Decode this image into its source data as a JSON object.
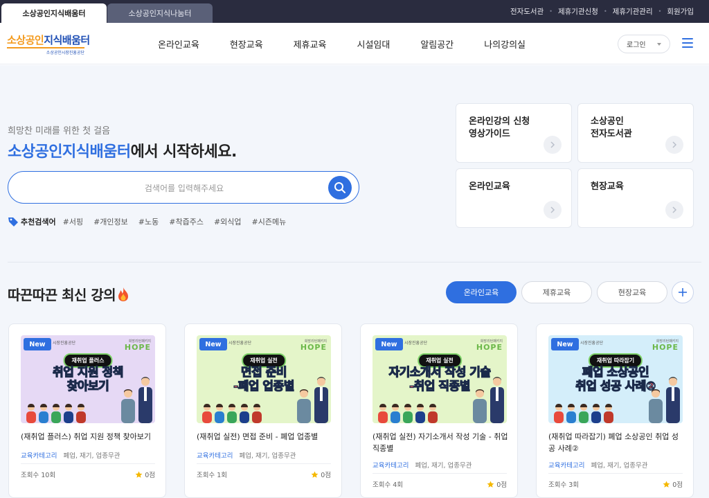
{
  "top_tabs": [
    "소상공인지식배움터",
    "소상공인지식나눔터"
  ],
  "top_links": [
    "전자도서관",
    "제휴기관신청",
    "제휴기관관리",
    "회원가입"
  ],
  "logo": {
    "main_orange": "소상공인",
    "main_blue": "지식배움터",
    "sub": "소상공인시장진흥공단"
  },
  "nav": [
    "온라인교육",
    "현장교육",
    "제휴교육",
    "시설임대",
    "알림공간",
    "나의강의실"
  ],
  "login_label": "로그인",
  "hero": {
    "subtitle": "희망찬 미래를 위한 첫 걸음",
    "title_highlight": "소상공인지식배움터",
    "title_rest": "에서 시작하세요.",
    "search_placeholder": "검색어를 입력해주세요",
    "reco_label": "추천검색어",
    "reco_keywords": [
      "#서핑",
      "#개인정보",
      "#노동",
      "#착즙주스",
      "#외식업",
      "#시즌메뉴"
    ]
  },
  "quick_cards": [
    {
      "title": "온라인강의 신청\n영상가이드"
    },
    {
      "title": "소상공인\n전자도서관"
    },
    {
      "title": "온라인교육"
    },
    {
      "title": "현장교육"
    }
  ],
  "section": {
    "title": "따끈따끈 최신 강의",
    "chips": [
      "온라인교육",
      "제휴교육",
      "현장교육"
    ]
  },
  "courses": [
    {
      "badge": "New",
      "org": "시장진흥공단",
      "hope_small": "희망리턴패키지",
      "hope": "HOPE",
      "pill": "재취업 플러스",
      "thumb_line1": "취업 지원 정책",
      "thumb_line2": "찾아보기",
      "title": "(재취업 플러스) 취업 지원 정책 찾아보기",
      "category_label": "교육카테고리",
      "tags": "폐업, 재기, 업종무관",
      "views": "조회수 10회",
      "score": "0점",
      "bg": "#e6d9f5"
    },
    {
      "badge": "New",
      "org": "시장진흥공단",
      "hope_small": "희망리턴패키지",
      "hope": "HOPE",
      "pill": "재취업 실전",
      "thumb_line1": "면접 준비",
      "thumb_line2": "-폐업 업종별",
      "title": "(재취업 실전) 면접 준비 - 폐업 업종별",
      "category_label": "교육카테고리",
      "tags": "폐업, 재기, 업종무관",
      "views": "조회수 1회",
      "score": "0점",
      "bg": "#e4f5c9"
    },
    {
      "badge": "New",
      "org": "시장진흥공단",
      "hope_small": "희망리턴패키지",
      "hope": "HOPE",
      "pill": "재취업 실전",
      "thumb_line1": "자기소개서 작성 기술",
      "thumb_line2": "-취업 직종별",
      "title": "(재취업 실전) 자기소개서 작성 기술 - 취업 직종별",
      "category_label": "교육카테고리",
      "tags": "폐업, 재기, 업종무관",
      "views": "조회수 4회",
      "score": "0점",
      "bg": "#e4f5c9"
    },
    {
      "badge": "New",
      "org": "시장진흥공단",
      "hope_small": "희망리턴패키지",
      "hope": "HOPE",
      "pill": "재취업 따라잡기",
      "thumb_line1": "폐업 소상공인",
      "thumb_line2": "취업 성공 사례②",
      "title": "(재취업 따라잡기) 폐업 소상공인 취업 성공 사례②",
      "category_label": "교육카테고리",
      "tags": "폐업, 재기, 업종무관",
      "views": "조회수 3회",
      "score": "0점",
      "bg": "#d4eefa"
    }
  ],
  "colors": {
    "primary": "#2f6fe0",
    "logo_orange": "#f39a1e",
    "topbar": "#2a2c3f"
  }
}
